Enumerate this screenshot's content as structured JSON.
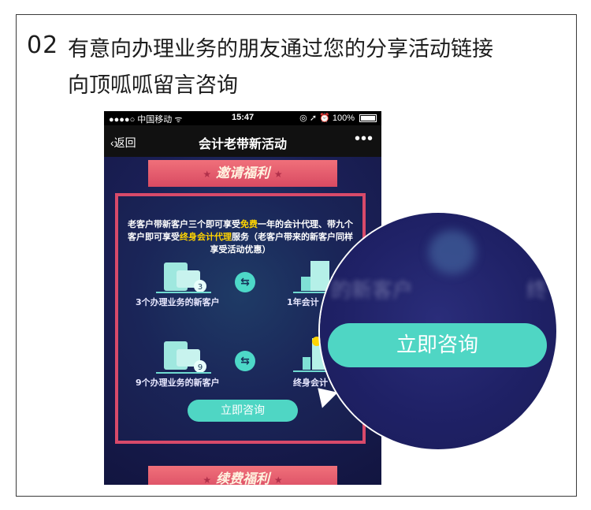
{
  "step": {
    "number": "02",
    "caption_line1": "有意向办理业务的朋友通过您的分享活动链接",
    "caption_line2": "向顶呱呱留言咨询"
  },
  "phone": {
    "status": {
      "carrier": "●●●●○ 中国移动 ᯤ",
      "time": "15:47",
      "right": "◎ ➚ ⏰ 100%"
    },
    "nav": {
      "back": "‹返回",
      "title": "会计老带新活动",
      "more": "•••"
    },
    "ribbon_top": "邀请福利",
    "intro_parts": [
      "老客户带新客户三个即可享受",
      "免费",
      "一年的会计代理、带九个客户即可享受",
      "终身会计代理",
      "服务（老客户带来的新客户同样享受活动优惠）"
    ],
    "items": [
      {
        "left": "3个办理业务的新客户",
        "right": "1年会计",
        "badge": "3"
      },
      {
        "left": "9个办理业务的新客户",
        "right": "终身会计",
        "badge": "9"
      }
    ],
    "swap_symbol": "⇆",
    "button": "立即咨询",
    "ribbon_bottom": "续费福利",
    "star": "★"
  },
  "magnifier": {
    "ghost_left": "的新客户",
    "ghost_right": "终",
    "button": "立即咨询"
  },
  "colors": {
    "accent": "#4fd6c4",
    "ribbon": "#d84a62",
    "highlight": "#ffd400",
    "bg": "#15193f"
  }
}
